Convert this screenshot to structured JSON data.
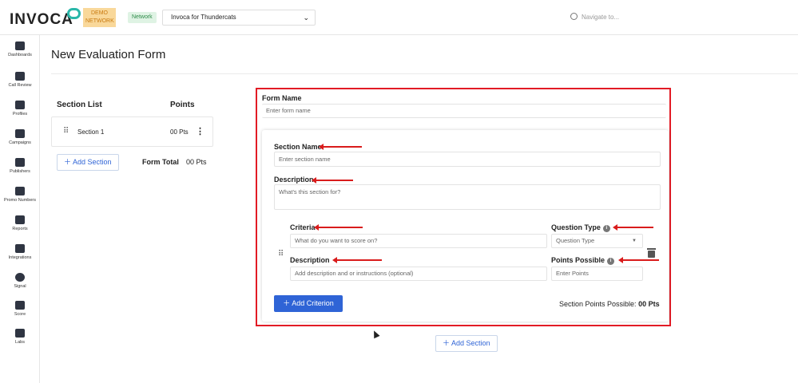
{
  "header": {
    "logo": "INVOCA",
    "demo_badge": "DEMO NETWORK",
    "network_label": "Network",
    "network_value": "Invoca for Thundercats",
    "search_placeholder": "Navigate to..."
  },
  "sidebar": {
    "items": [
      {
        "label": "Dashboards",
        "icon": "dashboard-icon"
      },
      {
        "label": "Call Review",
        "icon": "call-review-icon"
      },
      {
        "label": "Profiles",
        "icon": "profiles-icon"
      },
      {
        "label": "Campaigns",
        "icon": "campaigns-icon"
      },
      {
        "label": "Publishers",
        "icon": "publishers-icon"
      },
      {
        "label": "Promo Numbers",
        "icon": "keypad-icon"
      },
      {
        "label": "Reports",
        "icon": "reports-icon"
      },
      {
        "label": "Integrations",
        "icon": "integrations-icon"
      },
      {
        "label": "Signal",
        "icon": "signal-icon"
      },
      {
        "label": "Score",
        "icon": "score-icon"
      },
      {
        "label": "Labs",
        "icon": "labs-icon"
      }
    ]
  },
  "page": {
    "title": "New Evaluation Form"
  },
  "section_list": {
    "header": "Section List",
    "points_header": "Points",
    "sections": [
      {
        "name": "Section 1",
        "points": "00 Pts"
      }
    ],
    "add_button": "Add Section",
    "form_total_label": "Form Total",
    "form_total_value": "00 Pts"
  },
  "form": {
    "name_label": "Form Name",
    "name_placeholder": "Enter form name",
    "section": {
      "name_label": "Section Name",
      "name_placeholder": "Enter section name",
      "description_label": "Description",
      "description_placeholder": "What's this section for?",
      "criterion": {
        "criteria_label": "Criteria",
        "criteria_placeholder": "What do you want to score on?",
        "question_type_label": "Question Type",
        "question_type_placeholder": "Question Type",
        "description_label": "Description",
        "description_placeholder": "Add description and or instructions (optional)",
        "points_label": "Points Possible",
        "points_placeholder": "Enter Points"
      },
      "add_criterion_button": "Add Criterion",
      "section_points_label": "Section Points Possible:",
      "section_points_value": "00 Pts"
    },
    "add_section_button": "Add Section"
  },
  "colors": {
    "accent": "#2f64d6",
    "annotation": "#e21b25"
  }
}
